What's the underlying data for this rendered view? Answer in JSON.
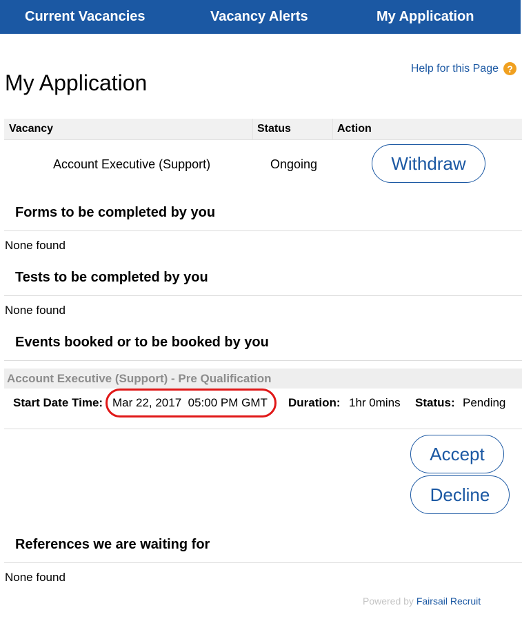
{
  "nav": {
    "current_vacancies": "Current Vacancies",
    "vacancy_alerts": "Vacancy Alerts",
    "my_application": "My Application"
  },
  "page": {
    "title": "My Application",
    "help_link": "Help for this Page",
    "help_icon_glyph": "?"
  },
  "application_table": {
    "headers": {
      "vacancy": "Vacancy",
      "status": "Status",
      "action": "Action"
    },
    "rows": [
      {
        "vacancy": "Account Executive (Support)",
        "status": "Ongoing",
        "action_label": "Withdraw"
      }
    ]
  },
  "sections": {
    "forms": {
      "title": "Forms to be completed by you",
      "empty": "None found"
    },
    "tests": {
      "title": "Tests to be completed by you",
      "empty": "None found"
    },
    "events": {
      "title": "Events booked or to be booked by you"
    },
    "references": {
      "title": "References we are waiting for",
      "empty": "None found"
    }
  },
  "event": {
    "name": "Account Executive (Support) - Pre Qualification",
    "start_label": "Start Date Time:",
    "start_value": "Mar 22, 2017  05:00 PM GMT",
    "duration_label": "Duration:",
    "duration_value": "1hr 0mins",
    "status_label": "Status:",
    "status_value": "Pending",
    "accept_label": "Accept",
    "decline_label": "Decline"
  },
  "footer": {
    "powered_by": "Powered by",
    "brand": "Fairsail Recruit"
  },
  "colors": {
    "nav_bg": "#1b58a3",
    "accent": "#1b58a3",
    "help_icon": "#f0a020",
    "highlight": "#e01717"
  }
}
